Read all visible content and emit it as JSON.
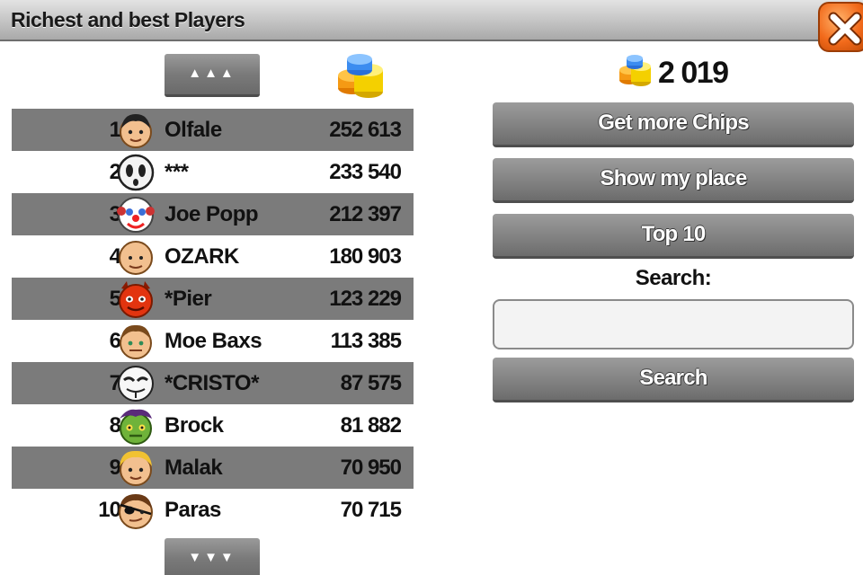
{
  "window": {
    "title": "Richest and best Players"
  },
  "paging": {
    "up_label": "▲▲▲",
    "down_label": "▼▼▼"
  },
  "icons": {
    "close": "close-icon",
    "chips": "chips-icon"
  },
  "colors": {
    "row_shade": "#7b7b7b",
    "button": "#858585",
    "close": "#f26a1b"
  },
  "leaderboard": [
    {
      "rank": "1",
      "name": "Olfale",
      "score": "252 613",
      "avatar": "man-dark-hair-avatar",
      "shaded": true
    },
    {
      "rank": "2",
      "name": "***",
      "score": "233 540",
      "avatar": "ghost-mask-avatar",
      "shaded": false
    },
    {
      "rank": "3",
      "name": "Joe Popp",
      "score": "212 397",
      "avatar": "clown-avatar",
      "shaded": true
    },
    {
      "rank": "4",
      "name": "OZARK",
      "score": "180 903",
      "avatar": "bald-man-avatar",
      "shaded": false
    },
    {
      "rank": "5",
      "name": "*Pier",
      "score": "123 229",
      "avatar": "red-devil-avatar",
      "shaded": true
    },
    {
      "rank": "6",
      "name": "Moe Baxs",
      "score": "113 385",
      "avatar": "man-brown-hair-avatar",
      "shaded": false
    },
    {
      "rank": "7",
      "name": "*CRISTO*",
      "score": "87 575",
      "avatar": "anonymous-mask-avatar",
      "shaded": true
    },
    {
      "rank": "8",
      "name": "Brock",
      "score": "81 882",
      "avatar": "green-zombie-avatar",
      "shaded": false
    },
    {
      "rank": "9",
      "name": "Malak",
      "score": "70 950",
      "avatar": "blonde-man-avatar",
      "shaded": true
    },
    {
      "rank": "10",
      "name": "Paras",
      "score": "70 715",
      "avatar": "pirate-eyepatch-avatar",
      "shaded": false
    }
  ],
  "sidebar": {
    "balance": "2 019",
    "get_chips_label": "Get more Chips",
    "show_place_label": "Show my place",
    "top10_label": "Top 10",
    "search_label": "Search:",
    "search_value": "",
    "search_button_label": "Search"
  }
}
